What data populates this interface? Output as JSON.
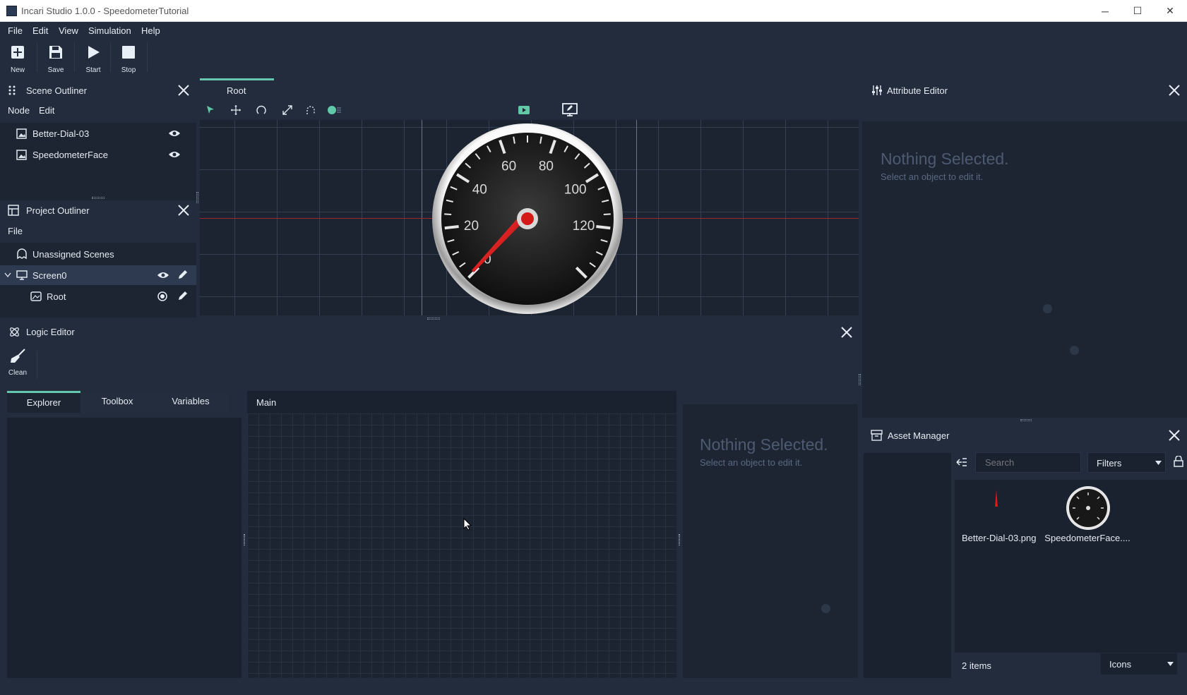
{
  "window": {
    "title": "Incari Studio 1.0.0 - SpeedometerTutorial",
    "minimize_icon": "─",
    "maximize_icon": "☐",
    "close_icon": "✕"
  },
  "menu": [
    "File",
    "Edit",
    "View",
    "Simulation",
    "Help"
  ],
  "toolbar": {
    "new": "New",
    "save": "Save",
    "start": "Start",
    "stop": "Stop"
  },
  "scene_outliner": {
    "title": "Scene Outliner",
    "menu": [
      "Node",
      "Edit"
    ],
    "items": [
      "Better-Dial-03",
      "SpeedometerFace"
    ]
  },
  "project_outliner": {
    "title": "Project Outliner",
    "menu": [
      "File"
    ],
    "unassigned": "Unassigned Scenes",
    "screen": "Screen0",
    "root": "Root"
  },
  "viewport": {
    "tab": "Root",
    "gauge_labels": [
      "0",
      "20",
      "40",
      "60",
      "80",
      "100",
      "120"
    ]
  },
  "attribute_editor": {
    "title": "Attribute Editor",
    "nothing_title": "Nothing Selected.",
    "nothing_sub": "Select an object to edit it."
  },
  "logic_editor": {
    "title": "Logic Editor",
    "clean": "Clean",
    "tabs": [
      "Explorer",
      "Toolbox",
      "Variables"
    ],
    "canvas_tab": "Main",
    "nothing_title": "Nothing Selected.",
    "nothing_sub": "Select an object to edit it."
  },
  "asset_manager": {
    "title": "Asset Manager",
    "search_placeholder": "Search",
    "filters": "Filters",
    "assets": [
      "Better-Dial-03.png",
      "SpeedometerFace...."
    ],
    "count": "2 items",
    "view_mode": "Icons"
  },
  "colors": {
    "accent": "#66c7b0",
    "panel_bg": "#222c3c",
    "body_bg": "#1a2230",
    "needle": "#e01818"
  }
}
